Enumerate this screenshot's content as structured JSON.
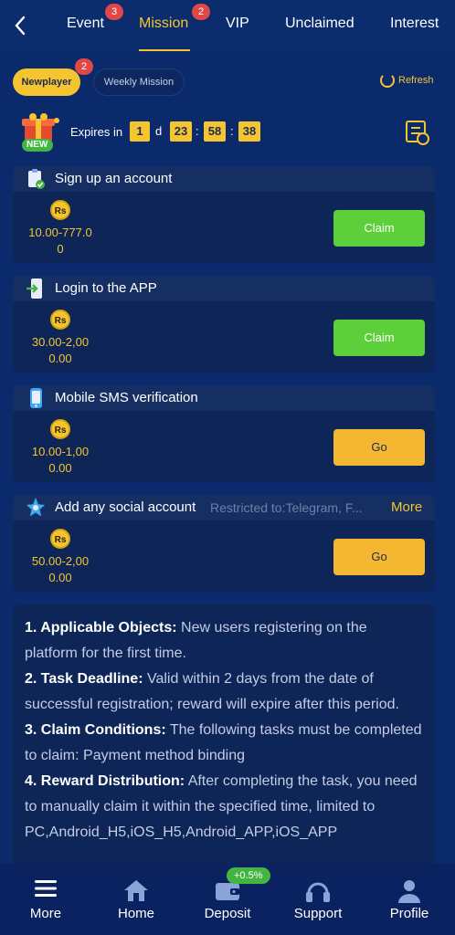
{
  "nav": {
    "tabs": [
      {
        "label": "Event",
        "badge": "3"
      },
      {
        "label": "Mission",
        "badge": "2",
        "active": true
      },
      {
        "label": "VIP"
      },
      {
        "label": "Unclaimed"
      },
      {
        "label": "Interest"
      }
    ]
  },
  "subtabs": {
    "newplayer": {
      "label": "Newplayer",
      "badge": "2"
    },
    "weekly": {
      "label": "Weekly Mission"
    },
    "refresh": "Refresh"
  },
  "expiry": {
    "label": "Expires in",
    "days": "1",
    "day_unit": "d",
    "hours": "23",
    "minutes": "58",
    "seconds": "38",
    "sep": ":",
    "gift_badge": "NEW"
  },
  "tasks": [
    {
      "title": "Sign up an account",
      "coin": "Rs",
      "reward_line1": "10.00-777.0",
      "reward_line2": "0",
      "button": "Claim",
      "icon": "clipboard-check-icon"
    },
    {
      "title": "Login to the APP",
      "coin": "Rs",
      "reward_line1": "30.00-2,00",
      "reward_line2": "0.00",
      "button": "Claim",
      "icon": "login-phone-icon"
    },
    {
      "title": "Mobile SMS verification",
      "coin": "Rs",
      "reward_line1": "10.00-1,00",
      "reward_line2": "0.00",
      "button": "Go",
      "icon": "phone-sms-icon"
    },
    {
      "title": "Add any social account",
      "restriction": "Restricted to:Telegram, F...",
      "more": "More",
      "coin": "Rs",
      "reward_line1": "50.00-2,00",
      "reward_line2": "0.00",
      "button": "Go",
      "icon": "social-star-icon"
    }
  ],
  "rules": [
    {
      "head": "1. Applicable Objects:",
      "text": " New users registering on the platform for the first time."
    },
    {
      "head": "2. Task Deadline:",
      "text": " Valid within 2 days from the date of successful registration; reward will expire after this period."
    },
    {
      "head": "3. Claim Conditions:",
      "text": " The following tasks must be completed to claim: Payment method binding"
    },
    {
      "head": "4. Reward Distribution:",
      "text": " After completing the task, you need to manually claim it within the specified time, limited to PC,Android_H5,iOS_H5,Android_APP,iOS_APP"
    }
  ],
  "bottom_nav": {
    "items": [
      {
        "label": "More"
      },
      {
        "label": "Home"
      },
      {
        "label": "Deposit"
      },
      {
        "label": "Support"
      },
      {
        "label": "Profile"
      }
    ],
    "deposit_promo": "+0.5%"
  },
  "colors": {
    "background": "#0a2a6b",
    "accent": "#f5c531",
    "claim": "#5ccf3a",
    "go": "#f5b731",
    "badge": "#e04747"
  }
}
